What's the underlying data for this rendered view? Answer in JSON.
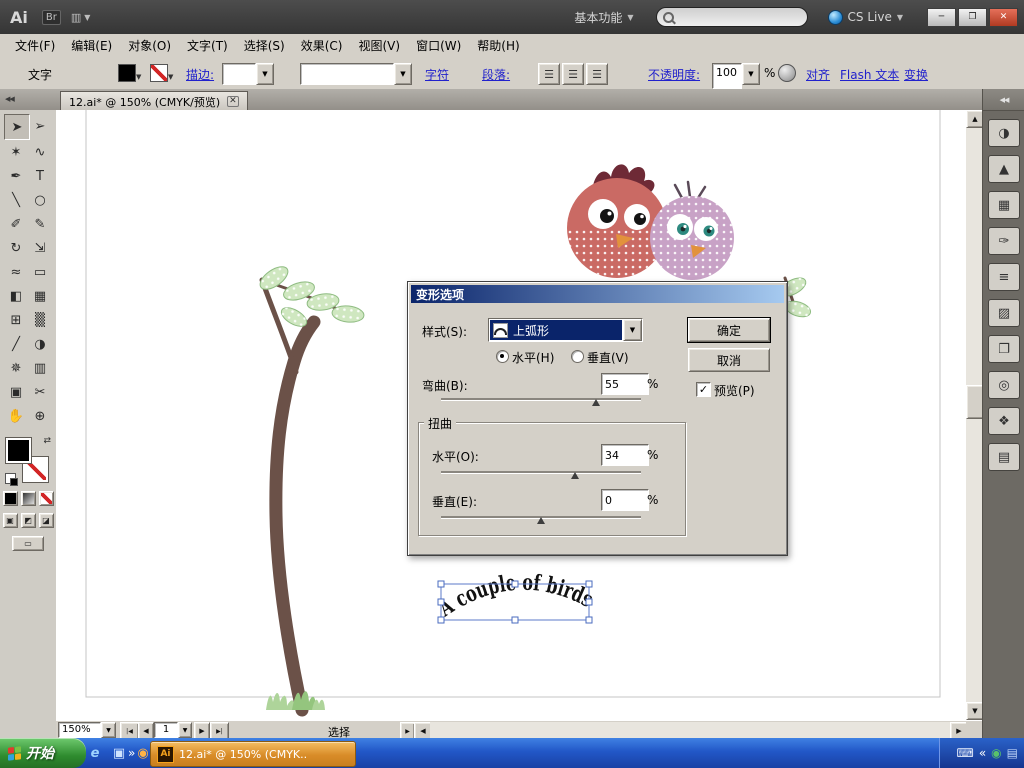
{
  "colors": {
    "classic_gray": "#d4d0c8",
    "dialog_title_blue": "#0a246a",
    "taskbar_blue": "#2257c7",
    "start_green": "#2e8b2e",
    "task_orange": "#d98c28",
    "bird_red": "#ca6a64",
    "bird_purple": "#c8a2c6",
    "leaf_green": "#cfe7c0",
    "branch_brown": "#6b5148",
    "selection_blue": "#5b79c9",
    "link_blue": "#2222cc"
  },
  "icons": {
    "dropdown": "▼",
    "up": "▲",
    "down": "▼",
    "left": "◀",
    "right": "▶",
    "first": "|◀",
    "last": "▶|",
    "close_tab": "✕",
    "collapse": "◀◀",
    "minimize": "─",
    "restore": "❐",
    "close": "✕",
    "check": "✓",
    "overflow": "»",
    "swap": "⇄",
    "screen_mode": "▭",
    "status_popup": "▶"
  },
  "titlebar": {
    "app_badge": "Ai",
    "bridge_badge": "Br",
    "arrange_glyph": "▥",
    "workspace": "基本功能",
    "cs_live": "CS Live",
    "search_placeholder": ""
  },
  "menubar": {
    "items": [
      "文件(F)",
      "编辑(E)",
      "对象(O)",
      "文字(T)",
      "选择(S)",
      "效果(C)",
      "视图(V)",
      "窗口(W)",
      "帮助(H)"
    ]
  },
  "controlbar": {
    "type_label": "文字",
    "stroke_link": "描边:",
    "character_link": "字符",
    "paragraph_link": "段落:",
    "opacity_link": "不透明度:",
    "opacity_value": "100",
    "percent": "%",
    "align_link": "对齐",
    "flash_link": "Flash 文本",
    "transform_link": "变换",
    "align_buttons": [
      {
        "name": "align-left-button",
        "glyph": "☰"
      },
      {
        "name": "align-center-button",
        "glyph": "☰"
      },
      {
        "name": "align-right-button",
        "glyph": "☰"
      }
    ]
  },
  "document_tab": {
    "title": "12.ai* @ 150% (CMYK/预览)"
  },
  "tools": [
    {
      "name": "selection-tool",
      "glyph": "➤"
    },
    {
      "name": "direct-selection-tool",
      "glyph": "➢"
    },
    {
      "name": "magic-wand-tool",
      "glyph": "✶"
    },
    {
      "name": "lasso-tool",
      "glyph": "∿"
    },
    {
      "name": "pen-tool",
      "glyph": "✒"
    },
    {
      "name": "type-tool",
      "glyph": "T"
    },
    {
      "name": "line-segment-tool",
      "glyph": "╲"
    },
    {
      "name": "ellipse-tool",
      "glyph": "○"
    },
    {
      "name": "paintbrush-tool",
      "glyph": "✐"
    },
    {
      "name": "pencil-tool",
      "glyph": "✎"
    },
    {
      "name": "rotate-tool",
      "glyph": "↻"
    },
    {
      "name": "scale-tool",
      "glyph": "⇲"
    },
    {
      "name": "width-tool",
      "glyph": "≈"
    },
    {
      "name": "free-transform-tool",
      "glyph": "▭"
    },
    {
      "name": "shape-builder-tool",
      "glyph": "◧"
    },
    {
      "name": "perspective-grid-tool",
      "glyph": "▦"
    },
    {
      "name": "mesh-tool",
      "glyph": "⊞"
    },
    {
      "name": "gradient-tool",
      "glyph": "▒"
    },
    {
      "name": "eyedropper-tool",
      "glyph": "╱"
    },
    {
      "name": "blend-tool",
      "glyph": "◑"
    },
    {
      "name": "symbol-sprayer-tool",
      "glyph": "✵"
    },
    {
      "name": "column-graph-tool",
      "glyph": "▥"
    },
    {
      "name": "artboard-tool",
      "glyph": "▣"
    },
    {
      "name": "slice-tool",
      "glyph": "✂"
    },
    {
      "name": "hand-tool",
      "glyph": "✋"
    },
    {
      "name": "zoom-tool",
      "glyph": "⊕"
    }
  ],
  "dock_panels": [
    {
      "name": "color-panel",
      "glyph": "◑"
    },
    {
      "name": "color-guide-panel",
      "glyph": "▲"
    },
    {
      "name": "swatches-panel",
      "glyph": "▦"
    },
    {
      "name": "brushes-panel",
      "glyph": "✑"
    },
    {
      "name": "stroke-panel",
      "glyph": "≡"
    },
    {
      "name": "gradient-panel",
      "glyph": "▨"
    },
    {
      "name": "transparency-panel",
      "glyph": "❐"
    },
    {
      "name": "appearance-panel",
      "glyph": "◎"
    },
    {
      "name": "graphic-styles-panel",
      "glyph": "❖"
    },
    {
      "name": "layers-panel",
      "glyph": "▤"
    }
  ],
  "dialog": {
    "title": "变形选项",
    "style_label": "样式(S):",
    "style_value": "上弧形",
    "horizontal_radio": "水平(H)",
    "vertical_radio": "垂直(V)",
    "bend_label": "弯曲(B):",
    "bend_value": "55",
    "distort_group": "扭曲",
    "h_distort_label": "水平(O):",
    "h_distort_value": "34",
    "v_distort_label": "垂直(E):",
    "v_distort_value": "0",
    "percent": "%",
    "ok_button": "确定",
    "cancel_button": "取消",
    "preview_checkbox": "预览(P)"
  },
  "canvas": {
    "warped_text": "A couple of birds"
  },
  "statusbar": {
    "zoom": "150%",
    "page": "1",
    "status": "选择"
  },
  "taskbar": {
    "start_label": "开始",
    "task_label": "12.ai* @ 150% (CMYK..",
    "quick_launch": [
      {
        "name": "ie-icon",
        "glyph": "e",
        "color": "#9ed3ff"
      },
      {
        "name": "show-desktop-icon",
        "glyph": "▣",
        "color": "#cfe3ff"
      },
      {
        "name": "media-player-icon",
        "glyph": "◉",
        "color": "#ffb347"
      }
    ],
    "tray_icons": [
      {
        "name": "keyboard-tray-icon",
        "glyph": "⌨",
        "color": "#e8eefc"
      },
      {
        "name": "collapse-tray-icon",
        "glyph": "«",
        "color": "#ffffff"
      },
      {
        "name": "antivirus-tray-icon",
        "glyph": "◉",
        "color": "#59c26a"
      },
      {
        "name": "display-tray-icon",
        "glyph": "▤",
        "color": "#bcd2f7"
      }
    ]
  }
}
